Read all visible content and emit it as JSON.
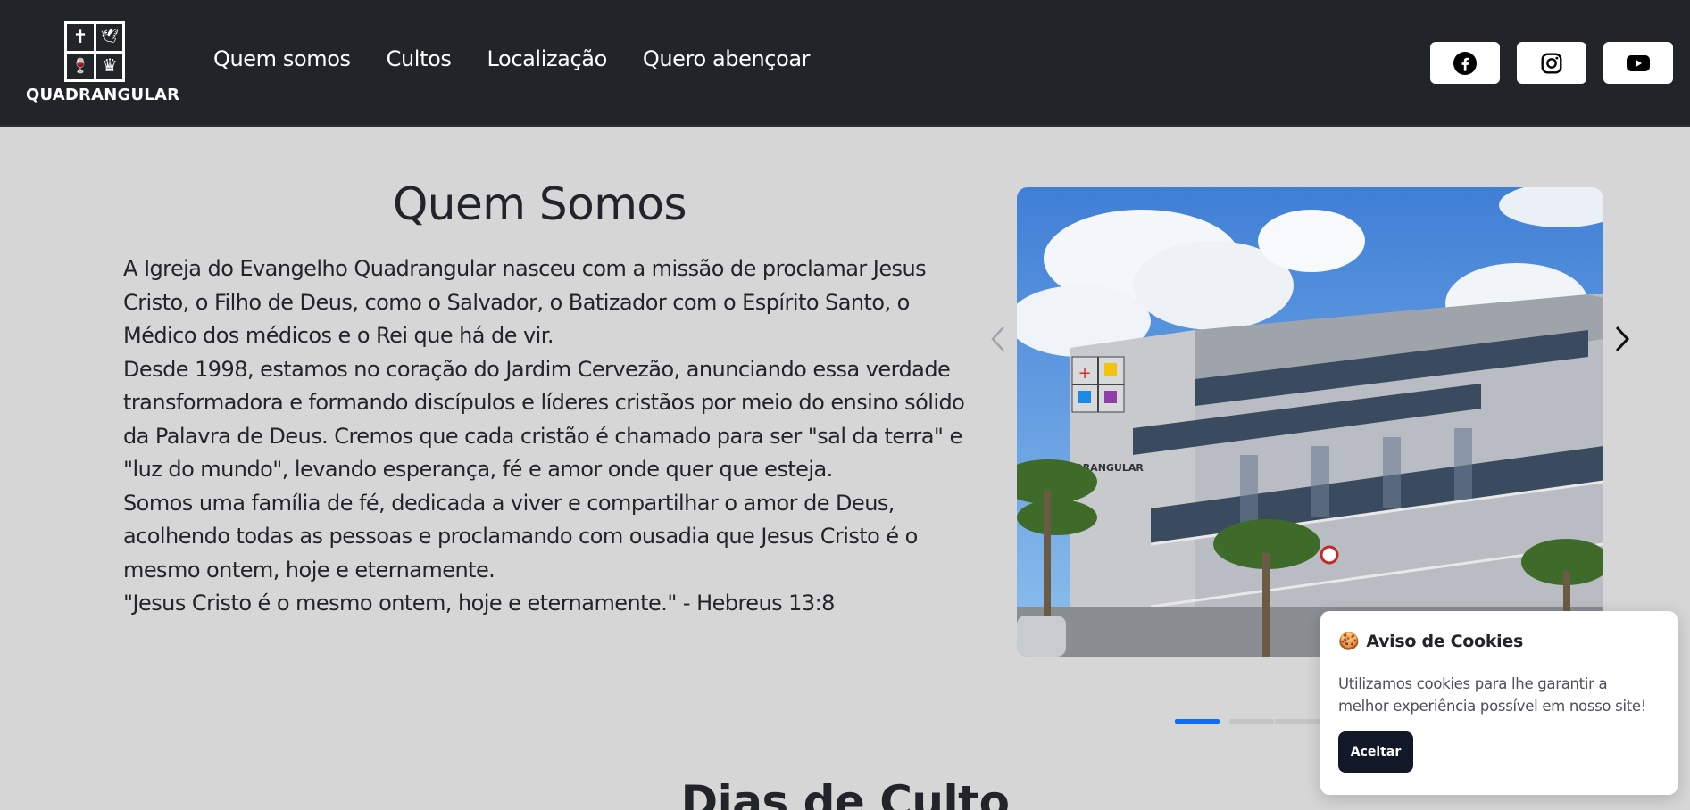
{
  "brand": {
    "name": "QUADRANGULAR",
    "symbols": [
      "✝",
      "🕊",
      "🍷",
      "♛"
    ]
  },
  "nav": {
    "links": [
      "Quem somos",
      "Cultos",
      "Localização",
      "Quero abençoar"
    ]
  },
  "social": [
    {
      "icon": "facebook-icon"
    },
    {
      "icon": "instagram-icon"
    },
    {
      "icon": "youtube-icon"
    }
  ],
  "about": {
    "title": "Quem Somos",
    "paragraphs": [
      "A Igreja do Evangelho Quadrangular nasceu com a missão de proclamar Jesus Cristo, o Filho de Deus, como o Salvador, o Batizador com o Espírito Santo, o Médico dos médicos e o Rei que há de vir.",
      "Desde 1998, estamos no coração do Jardim Cervezão, anunciando essa verdade transformadora e formando discípulos e líderes cristãos por meio do ensino sólido da Palavra de Deus. Cremos que cada cristão é chamado para ser \"sal da terra\" e \"luz do mundo\", levando esperança, fé e amor onde quer que esteja.",
      "Somos uma família de fé, dedicada a viver e compartilhar o amor de Deus, acolhendo todas as pessoas e proclamando com ousadia que Jesus Cristo é o mesmo ontem, hoje e eternamente.",
      "\"Jesus Cristo é o mesmo ontem, hoje e eternamente.\" - Hebreus 13:8"
    ]
  },
  "carousel": {
    "image_sign": "QUADRANGULAR",
    "slides": 3,
    "active_slide": 1
  },
  "section2": {
    "title": "Dias de Culto"
  },
  "cookie": {
    "emoji": "🍪",
    "title": "Aviso de Cookies",
    "text": "Utilizamos cookies para lhe garantir a melhor experiência possível em nosso site!",
    "accept_label": "Aceitar"
  },
  "colors": {
    "navbar": "#212529",
    "background": "#d6d6d6",
    "accent": "#0d6efd",
    "cookie_button": "#111827"
  }
}
